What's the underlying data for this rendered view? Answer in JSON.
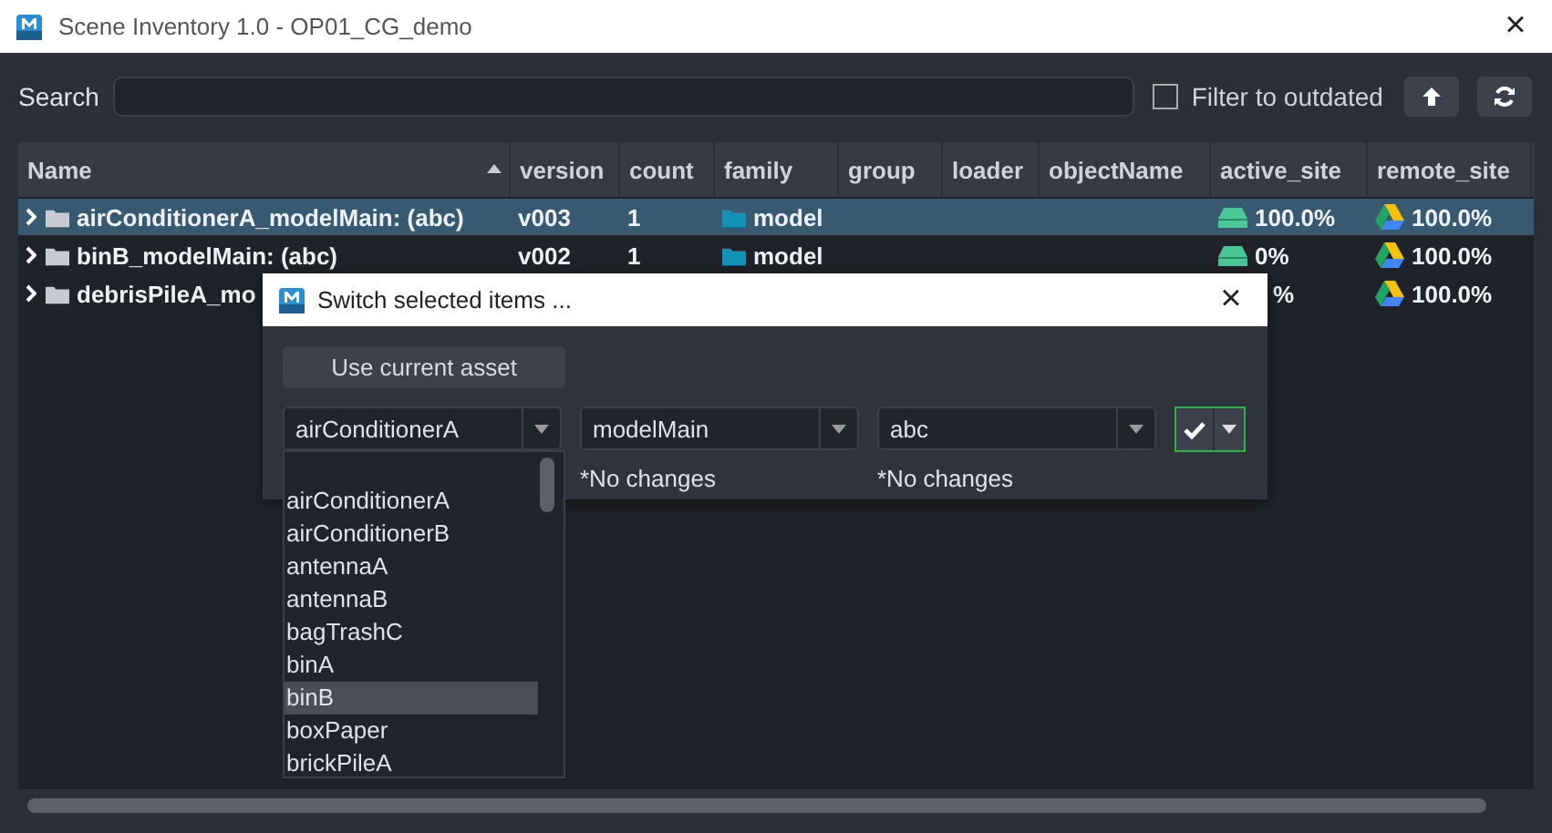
{
  "window": {
    "title": "Scene Inventory 1.0 - OP01_CG_demo",
    "close": "×"
  },
  "toolbar": {
    "search_label": "Search",
    "filter": {
      "label": "Filter to outdated",
      "checked": false
    }
  },
  "table": {
    "columns": [
      {
        "label": "Name",
        "sorted": true
      },
      {
        "label": "version",
        "sorted": false
      },
      {
        "label": "count",
        "sorted": false
      },
      {
        "label": "family",
        "sorted": false
      },
      {
        "label": "group",
        "sorted": false
      },
      {
        "label": "loader",
        "sorted": false
      },
      {
        "label": "objectName",
        "sorted": false
      },
      {
        "label": "active_site",
        "sorted": false
      },
      {
        "label": "remote_site",
        "sorted": false
      }
    ],
    "rows": [
      {
        "name": "airConditionerA_modelMain: (abc)",
        "version": "v003",
        "count": "1",
        "family": "model",
        "active_site": "100.0%",
        "active_icon": true,
        "remote_site": "100.0%",
        "selected": true
      },
      {
        "name": "binB_modelMain: (abc)",
        "version": "v002",
        "count": "1",
        "family": "model",
        "active_site": "0%",
        "active_icon": true,
        "remote_site": "100.0%",
        "selected": false
      },
      {
        "name": "debrisPileA_mo",
        "active_site": "%",
        "active_icon": false,
        "remote_site": "100.0%",
        "selected": false
      }
    ]
  },
  "dialog": {
    "title": "Switch selected items ...",
    "close": "×",
    "use_current": "Use current asset",
    "combos": [
      {
        "value": "airConditionerA"
      },
      {
        "value": "modelMain",
        "note": "*No changes"
      },
      {
        "value": "abc",
        "note": "*No changes"
      }
    ],
    "dropdown": [
      {
        "label": "airConditionerA",
        "selected": false
      },
      {
        "label": "airConditionerB",
        "selected": false
      },
      {
        "label": "antennaA",
        "selected": false
      },
      {
        "label": "antennaB",
        "selected": false
      },
      {
        "label": "bagTrashC",
        "selected": false
      },
      {
        "label": "binA",
        "selected": false
      },
      {
        "label": "binB",
        "selected": true
      },
      {
        "label": "boxPaper",
        "selected": false
      },
      {
        "label": "brickPileA",
        "selected": false
      }
    ]
  }
}
